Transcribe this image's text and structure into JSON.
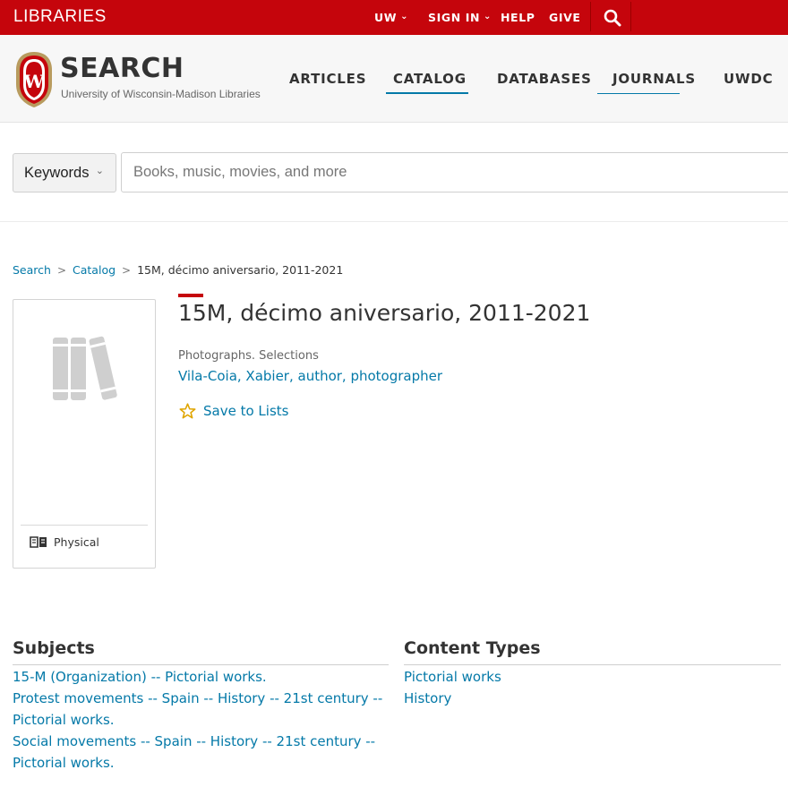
{
  "topbar": {
    "brand": "LIBRARIES",
    "nav": [
      {
        "label": "UW",
        "dropdown": true
      },
      {
        "label": "SIGN IN",
        "dropdown": true
      },
      {
        "label": "HELP",
        "dropdown": false
      },
      {
        "label": "GIVE",
        "dropdown": false
      }
    ],
    "chevron_glyph": "⌄",
    "search_icon": "search-icon"
  },
  "header": {
    "crest_letter": "W",
    "title": "SEARCH",
    "subtitle": "University of Wisconsin-Madison Libraries",
    "nav": [
      {
        "label": "ARTICLES"
      },
      {
        "label": "CATALOG",
        "active": true
      },
      {
        "label": "DATABASES"
      },
      {
        "label": "JOURNALS",
        "underlined": true
      },
      {
        "label": "UWDC"
      }
    ]
  },
  "search": {
    "scope_label": "Keywords",
    "placeholder": "Books, music, movies, and more",
    "value": ""
  },
  "breadcrumb": {
    "items": [
      "Search",
      "Catalog"
    ],
    "current": "15M, décimo aniversario, 2011-2021",
    "separator": ">"
  },
  "record": {
    "title": "15M, décimo aniversario, 2011-2021",
    "genre": "Photographs. Selections",
    "author": "Vila-Coia, Xabier, author, photographer",
    "save_label": "Save to Lists",
    "format_label": "Physical",
    "cover_icon": "books-icon",
    "format_icon": "book-open-icon",
    "save_icon": "star-icon"
  },
  "subjects": {
    "heading": "Subjects",
    "items": [
      [
        "15-M (Organization) -- Pictorial works."
      ],
      [
        "Protest movements -- Spain -- History -- 21st century --",
        "Pictorial works."
      ],
      [
        "Social movements -- Spain -- History -- 21st century --",
        "Pictorial works."
      ]
    ]
  },
  "content_types": {
    "heading": "Content Types",
    "items": [
      "Pictorial works",
      "History"
    ]
  },
  "colors": {
    "brand_red": "#c5050c",
    "link_blue": "#0479a8",
    "star_gold": "#e0a500"
  }
}
